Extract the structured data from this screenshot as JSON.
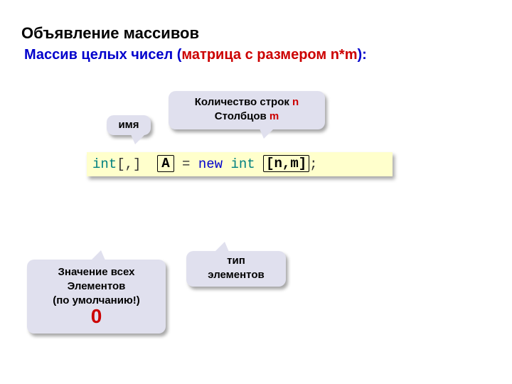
{
  "title": "Объявление массивов",
  "subtitle": {
    "prefix": "Массив целых чисел (",
    "red": "матрица с размером  n*m",
    "suffix": "):"
  },
  "callouts": {
    "name": "имя",
    "rowscols": {
      "line1_prefix": "Количество строк ",
      "line1_red": "n",
      "line2_prefix": "Столбцов ",
      "line2_red": "m"
    },
    "defaultVal": {
      "line1": "Значение всех",
      "line2": "Элементов",
      "line3": "(по умолчанию!)",
      "big": "0"
    },
    "type": {
      "line1": "тип",
      "line2": "элементов"
    }
  },
  "code": {
    "t_int": "int",
    "bracket_comma": "[,]",
    "var_A": "A",
    "equals": " = ",
    "kw_new": "new",
    "dims": "[n,m]",
    "semi": ";"
  }
}
